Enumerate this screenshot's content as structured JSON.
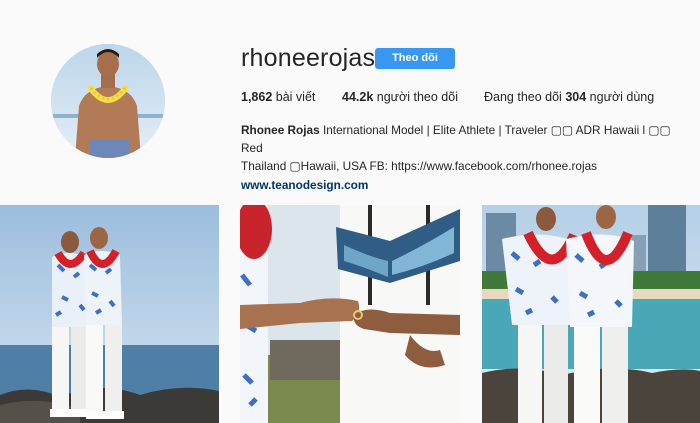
{
  "profile": {
    "username": "rhoneerojas",
    "follow_label": "Theo dõi",
    "posts_count": "1,862",
    "posts_label": "bài viết",
    "followers_count": "44.2k",
    "followers_label": "người theo dõi",
    "following_prefix": "Đang theo dõi",
    "following_count": "304",
    "following_label": "người dùng",
    "full_name": "Rhonee Rojas",
    "bio_line1": "International Model | Elite Athlete | Traveler ▢▢ ADR Hawaii l ▢▢ Red",
    "bio_line2": "Thailand ▢Hawaii, USA FB: https://www.facebook.com/rhonee.rojas",
    "website": "www.teanodesign.com"
  },
  "colors": {
    "accent": "#3897f0",
    "link": "#003569",
    "background": "#fafafa",
    "text": "#262626"
  },
  "posts": [
    {
      "name": "post-couple-kiss-beach"
    },
    {
      "name": "post-wedding-ring-exchange"
    },
    {
      "name": "post-couple-leis-beach"
    }
  ]
}
